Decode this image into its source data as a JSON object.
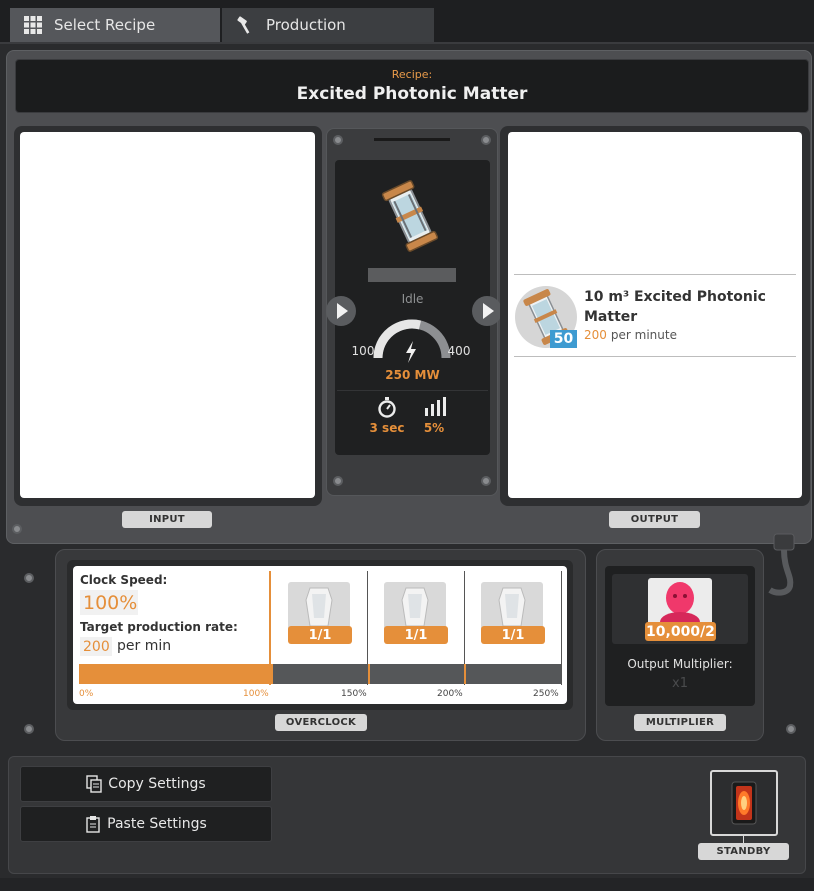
{
  "tabs": {
    "select_recipe": "Select Recipe",
    "production": "Production"
  },
  "recipe": {
    "label": "Recipe:",
    "name": "Excited Photonic Matter"
  },
  "machine": {
    "status": "Idle",
    "power_min": "100",
    "power_max": "400",
    "power_current": "250 MW",
    "cycle_time": "3 sec",
    "productivity": "5%"
  },
  "output_item": {
    "name": "10 m³ Excited Photonic Matter",
    "rate_value": "200",
    "rate_unit": "per minute",
    "stack": "50"
  },
  "sections": {
    "input": "INPUT",
    "output": "OUTPUT",
    "overclock": "OVERCLOCK",
    "multiplier": "MULTIPLIER",
    "standby": "STANDBY"
  },
  "overclock": {
    "clock_speed_label": "Clock Speed:",
    "clock_speed_value": "100%",
    "target_label": "Target production rate:",
    "target_value": "200",
    "target_unit": "per min",
    "fill_percent": 100,
    "shards": [
      "1/1",
      "1/1",
      "1/1"
    ],
    "ticks": [
      "0%",
      "100%",
      "150%",
      "200%",
      "250%"
    ]
  },
  "multiplier": {
    "value": "10,000/2",
    "label": "Output Multiplier:",
    "factor": "x1"
  },
  "buttons": {
    "copy": "Copy Settings",
    "paste": "Paste Settings"
  },
  "colors": {
    "accent": "#e58f3a",
    "badge_blue": "#3e9bd1",
    "standby_glow": "#ff5a1f"
  }
}
